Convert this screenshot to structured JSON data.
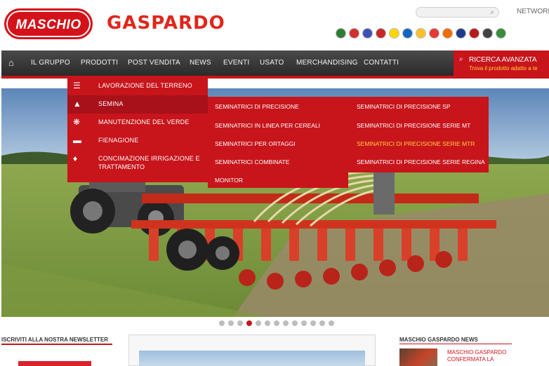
{
  "header": {
    "logo_text": "MASCHIO",
    "brand_word": "GASPARDO",
    "network_label": "NETWORK",
    "search": {
      "placeholder": "",
      "icon": "search-icon"
    },
    "flags": [
      "#2e7d32",
      "#d32f2f",
      "#3f51b5",
      "#c62828",
      "#ffd600",
      "#1565c0",
      "#fbc02d",
      "#e53935",
      "#ef6c00",
      "#1e3a8a",
      "#b71c1c",
      "#424242",
      "#388e3c"
    ]
  },
  "nav": {
    "items": [
      "IL GRUPPO",
      "PRODOTTI",
      "POST VENDITA",
      "NEWS",
      "EVENTI",
      "USATO",
      "MERCHANDISING",
      "CONTATTI"
    ],
    "advanced_search": "RICERCA AVANZATA",
    "advanced_search_sub": "Trova il prodotto adatto a te"
  },
  "menus": {
    "level1": [
      {
        "label": "LAVORAZIONE DEL TERRENO",
        "icon": "tillage-icon"
      },
      {
        "label": "SEMINA",
        "icon": "seed-icon"
      },
      {
        "label": "MANUTENZIONE DEL VERDE",
        "icon": "grass-icon"
      },
      {
        "label": "FIENAGIONE",
        "icon": "hay-icon"
      },
      {
        "label": "CONCIMAZIONE IRRIGAZIONE E",
        "label2": "TRATTAMENTO",
        "icon": "drop-icon"
      }
    ],
    "level2": [
      "SEMINATRICI DI PRECISIONE",
      "SEMINATRICI IN LINEA PER CEREALI",
      "SEMINATRICI PER ORTAGGI",
      "SEMINATRICI COMBINATE",
      "MONITOR"
    ],
    "level3": [
      "SEMINATRICI DI PRECISIONE SP",
      "SEMINATRICI DI PRECISIONE SERIE MT",
      "SEMINATRICI DI PRECISIONE SERIE MTR",
      "SEMINATRICI DI PRECISIONE SERIE REGINA"
    ],
    "level3_highlight_index": 2
  },
  "slider": {
    "dot_count": 13,
    "active_index": 3
  },
  "newsletter": {
    "title": "ISCRIVITI ALLA NOSTRA NEWSLETTER"
  },
  "news": {
    "title": "MASCHIO GASPARDO NEWS",
    "item_line1": "MASCHIO GASPARDO",
    "item_line2": "CONFERMATA LA"
  },
  "colors": {
    "brand_red": "#c8141b",
    "nav_dark": "#333333",
    "highlight_yellow": "#ffd23a"
  }
}
